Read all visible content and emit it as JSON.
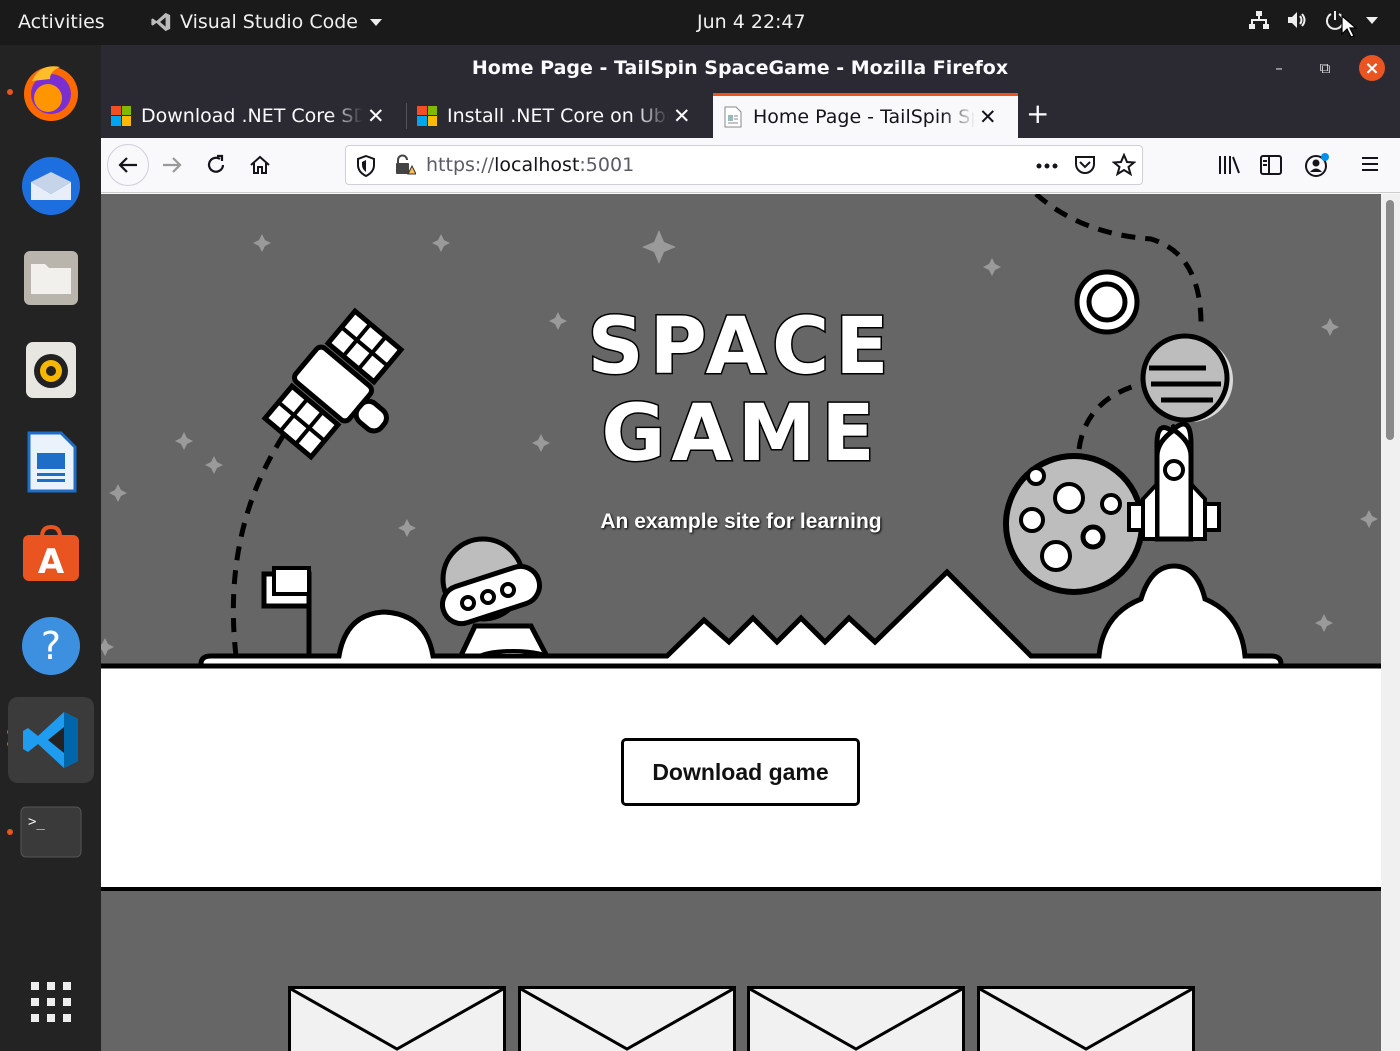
{
  "topbar": {
    "activities": "Activities",
    "app_name": "Visual Studio Code",
    "clock": "Jun 4  22:47"
  },
  "dock": {
    "items": [
      "firefox",
      "thunderbird",
      "files",
      "rhythmbox",
      "libreoffice-writer",
      "ubuntu-software",
      "help",
      "visual-studio-code",
      "terminal",
      "show-applications"
    ]
  },
  "window": {
    "title": "Home Page - TailSpin SpaceGame - Mozilla Firefox"
  },
  "tabs": [
    {
      "label": "Download .NET Core SDK"
    },
    {
      "label": "Install .NET Core on Ubuntu"
    },
    {
      "label": "Home Page - TailSpin SpaceGame"
    }
  ],
  "urlbar": {
    "scheme": "https://",
    "host": "localhost",
    "port": ":5001"
  },
  "page": {
    "logo_line1": "SPACE",
    "logo_line2": "GAME",
    "tagline": "An example site for learning",
    "download_button": "Download game"
  },
  "colors": {
    "ubuntu_orange": "#e95420",
    "firefox_chrome": "#2b2a33",
    "hero_gray": "#666666"
  }
}
